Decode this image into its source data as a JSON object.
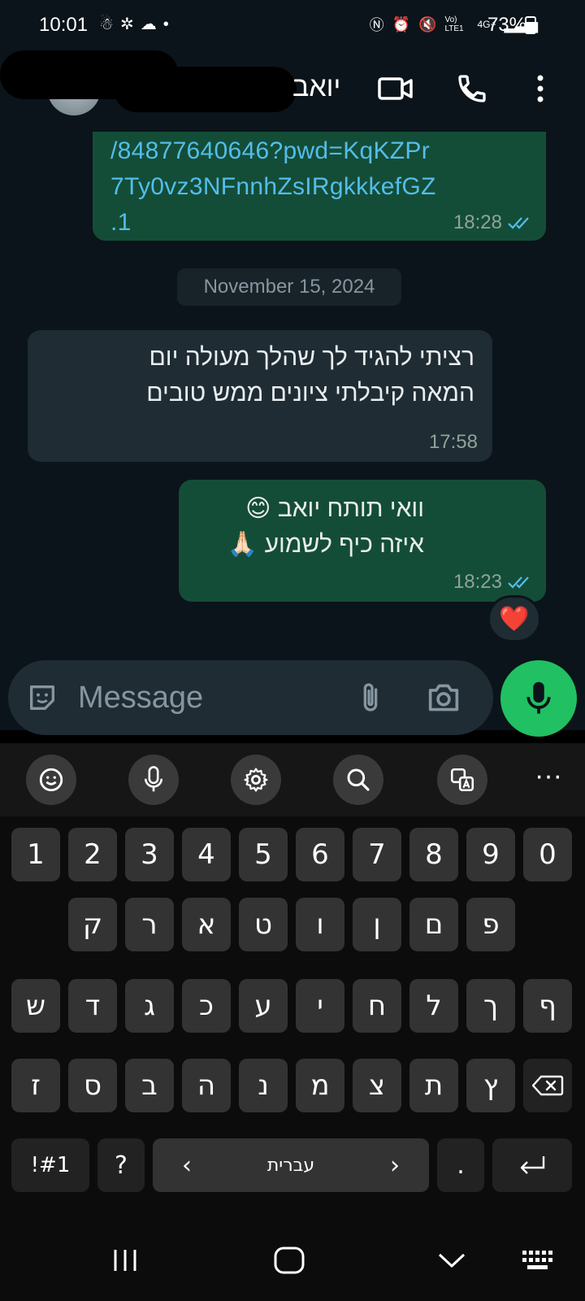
{
  "status_bar": {
    "time": "10:01",
    "battery": "73%",
    "network": "4G+",
    "volte": "Vo) LTE1"
  },
  "header": {
    "contact_name": "יואב"
  },
  "messages": [
    {
      "direction": "outgoing",
      "link_lines": [
        "/84877640646?pwd=KqKZPr",
        "7Ty0vz3NFnnhZsIRgkkkefGZ",
        ".1"
      ],
      "time": "18:28",
      "status": "read"
    },
    {
      "type": "date_divider",
      "text": "November 15, 2024"
    },
    {
      "direction": "incoming",
      "lines": [
        "רציתי להגיד לך שהלך מעולה יום",
        "המאה קיבלתי ציונים ממש טובים"
      ],
      "time": "17:58"
    },
    {
      "direction": "outgoing",
      "lines": [
        "וואי תותח יואב 😊",
        "איזה כיף לשמוע 🙏🏻"
      ],
      "time": "18:23",
      "status": "read",
      "reaction": "❤️"
    }
  ],
  "composer": {
    "placeholder": "Message"
  },
  "keyboard": {
    "number_row": [
      "1",
      "2",
      "3",
      "4",
      "5",
      "6",
      "7",
      "8",
      "9",
      "0"
    ],
    "row1": [
      "ק",
      "ר",
      "א",
      "ט",
      "ו",
      "ן",
      "ם",
      "פ"
    ],
    "row2": [
      "ש",
      "ד",
      "ג",
      "כ",
      "ע",
      "י",
      "ח",
      "ל",
      "ך",
      "ף"
    ],
    "row3": [
      "ז",
      "ס",
      "ב",
      "ה",
      "נ",
      "מ",
      "צ",
      "ת",
      "ץ"
    ],
    "symbols_key": "!#1",
    "question_key": "?",
    "space_label": "עברית",
    "space_left_arrow": "‹",
    "space_right_arrow": "›",
    "period_key": "."
  },
  "colors": {
    "chat_bg": "#0b141a",
    "outgoing_bubble": "#144d37",
    "incoming_bubble": "#1f2c34",
    "link": "#53bdeb",
    "mic_button": "#21c063",
    "read_ticks": "#53bdeb"
  }
}
